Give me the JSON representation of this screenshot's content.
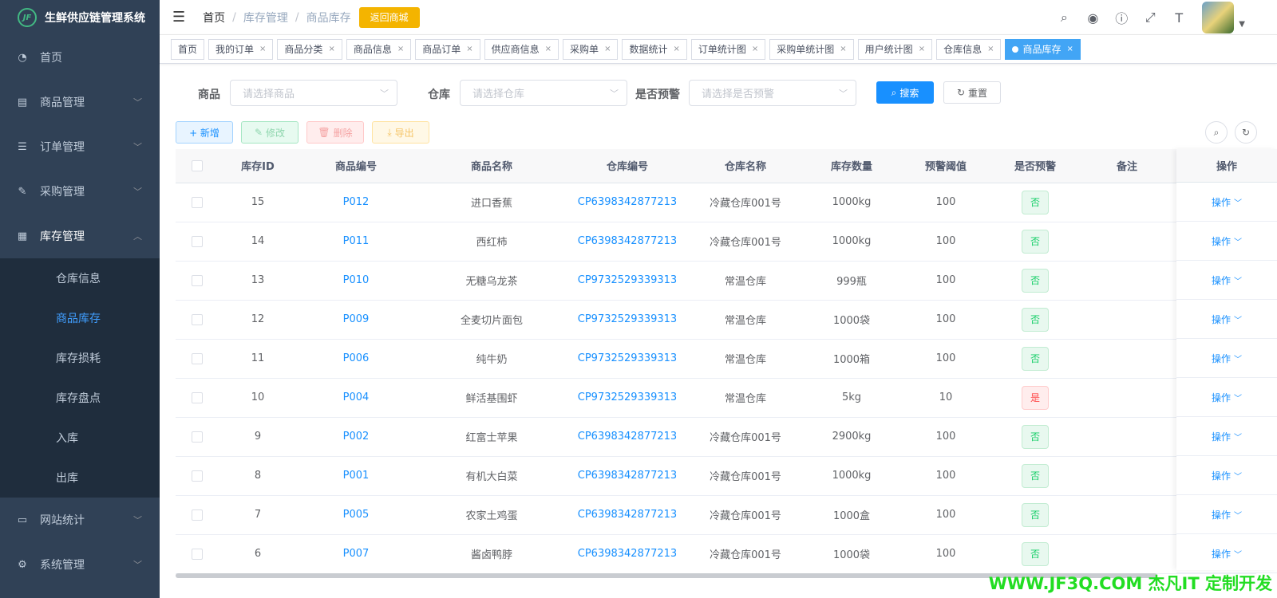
{
  "app": {
    "title": "生鲜供应链管理系统",
    "logo_text": "JF"
  },
  "sidebar": {
    "items": [
      {
        "label": "首页",
        "icon": "dashboard-icon"
      },
      {
        "label": "商品管理",
        "icon": "document-icon"
      },
      {
        "label": "订单管理",
        "icon": "list-icon"
      },
      {
        "label": "采购管理",
        "icon": "edit-icon"
      },
      {
        "label": "库存管理",
        "icon": "inventory-icon"
      },
      {
        "label": "网站统计",
        "icon": "monitor-icon"
      },
      {
        "label": "系统管理",
        "icon": "gear-icon"
      }
    ],
    "submenu": [
      "仓库信息",
      "商品库存",
      "库存损耗",
      "库存盘点",
      "入库",
      "出库"
    ],
    "active_sub": "商品库存"
  },
  "navbar": {
    "breadcrumb": [
      "首页",
      "库存管理",
      "商品库存"
    ],
    "back_button": "返回商城",
    "icons": [
      "search-icon",
      "github-icon",
      "question-icon",
      "fullscreen-icon",
      "font-size-icon"
    ]
  },
  "tags": [
    "首页",
    "我的订单",
    "商品分类",
    "商品信息",
    "商品订单",
    "供应商信息",
    "采购单",
    "数据统计",
    "订单统计图",
    "采购单统计图",
    "用户统计图",
    "仓库信息",
    "商品库存"
  ],
  "search": {
    "product_label": "商品",
    "product_placeholder": "请选择商品",
    "warehouse_label": "仓库",
    "warehouse_placeholder": "请选择仓库",
    "warn_label": "是否预警",
    "warn_placeholder": "请选择是否预警",
    "search_button": "搜索",
    "reset_button": "重置"
  },
  "toolbar": {
    "add": "+ 新增",
    "edit": "修改",
    "delete": "删除",
    "export": "导出"
  },
  "table": {
    "headers": [
      "库存ID",
      "商品编号",
      "商品名称",
      "仓库编号",
      "仓库名称",
      "库存数量",
      "预警阈值",
      "是否预警",
      "备注",
      "操作"
    ],
    "rows": [
      {
        "id": "15",
        "code": "P012",
        "name": "进口香蕉",
        "wh_code": "CP6398342877213",
        "wh_name": "冷藏仓库001号",
        "qty": "1000kg",
        "threshold": "100",
        "warn": "否"
      },
      {
        "id": "14",
        "code": "P011",
        "name": "西红柿",
        "wh_code": "CP6398342877213",
        "wh_name": "冷藏仓库001号",
        "qty": "1000kg",
        "threshold": "100",
        "warn": "否"
      },
      {
        "id": "13",
        "code": "P010",
        "name": "无糖乌龙茶",
        "wh_code": "CP9732529339313",
        "wh_name": "常温仓库",
        "qty": "999瓶",
        "threshold": "100",
        "warn": "否"
      },
      {
        "id": "12",
        "code": "P009",
        "name": "全麦切片面包",
        "wh_code": "CP9732529339313",
        "wh_name": "常温仓库",
        "qty": "1000袋",
        "threshold": "100",
        "warn": "否"
      },
      {
        "id": "11",
        "code": "P006",
        "name": "纯牛奶",
        "wh_code": "CP9732529339313",
        "wh_name": "常温仓库",
        "qty": "1000箱",
        "threshold": "100",
        "warn": "否"
      },
      {
        "id": "10",
        "code": "P004",
        "name": "鲜活基围虾",
        "wh_code": "CP9732529339313",
        "wh_name": "常温仓库",
        "qty": "5kg",
        "threshold": "10",
        "warn": "是"
      },
      {
        "id": "9",
        "code": "P002",
        "name": "红富士苹果",
        "wh_code": "CP6398342877213",
        "wh_name": "冷藏仓库001号",
        "qty": "2900kg",
        "threshold": "100",
        "warn": "否"
      },
      {
        "id": "8",
        "code": "P001",
        "name": "有机大白菜",
        "wh_code": "CP6398342877213",
        "wh_name": "冷藏仓库001号",
        "qty": "1000kg",
        "threshold": "100",
        "warn": "否"
      },
      {
        "id": "7",
        "code": "P005",
        "name": "农家土鸡蛋",
        "wh_code": "CP6398342877213",
        "wh_name": "冷藏仓库001号",
        "qty": "1000盒",
        "threshold": "100",
        "warn": "否"
      },
      {
        "id": "6",
        "code": "P007",
        "name": "酱卤鸭脖",
        "wh_code": "CP6398342877213",
        "wh_name": "冷藏仓库001号",
        "qty": "1000袋",
        "threshold": "100",
        "warn": "否"
      }
    ],
    "op_label": "操作"
  },
  "watermark": "WWW.JF3Q.COM 杰凡IT 定制开发"
}
